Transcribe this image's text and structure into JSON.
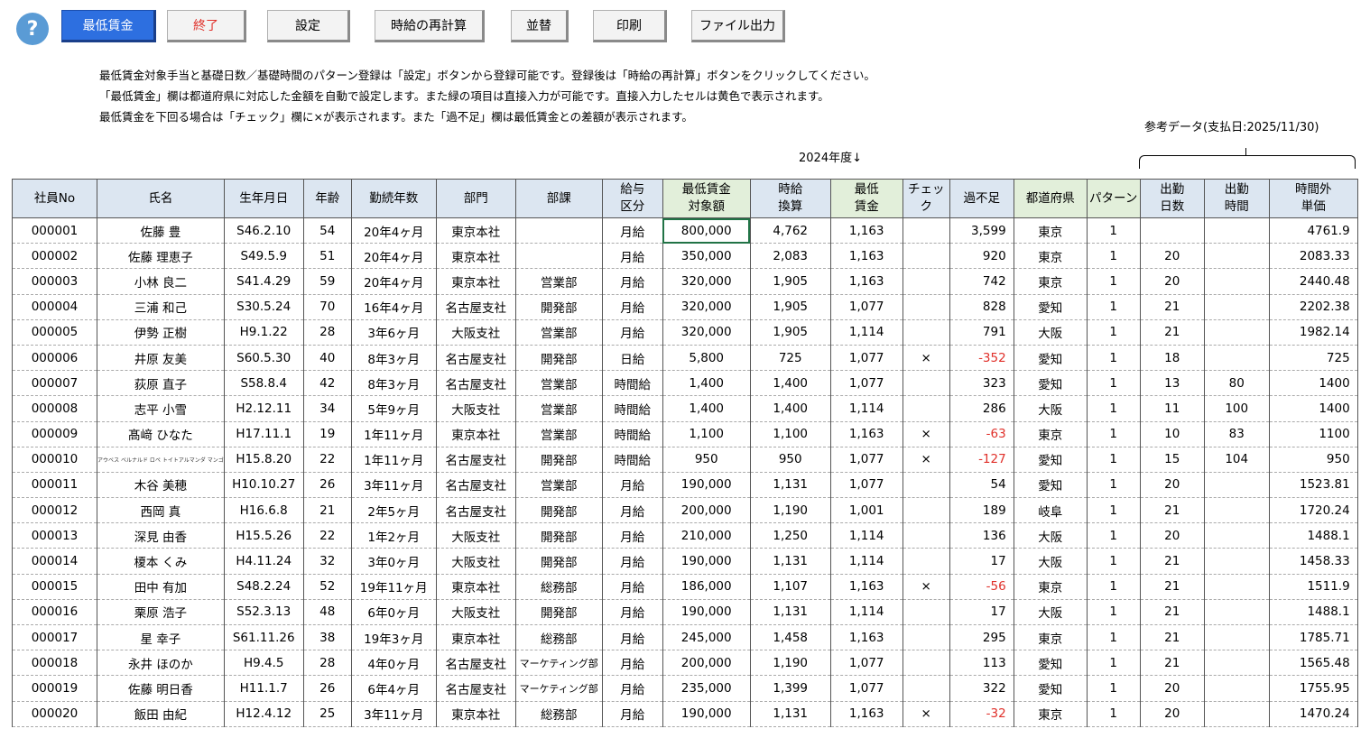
{
  "toolbar": {
    "help": "?",
    "minwage": "最低賃金",
    "exit": "終了",
    "settings": "設定",
    "recalc": "時給の再計算",
    "sort": "並替",
    "print": "印刷",
    "export": "ファイル出力"
  },
  "info": {
    "line1": "最低賃金対象手当と基礎日数／基礎時間のパターン登録は「設定」ボタンから登録可能です。登録後は「時給の再計算」ボタンをクリックしてください。",
    "line2": "「最低賃金」欄は都道府県に対応した金額を自動で設定します。また緑の項目は直接入力が可能です。直接入力したセルは黄色で表示されます。",
    "line3": "最低賃金を下回る場合は「チェック」欄に×が表示されます。また「過不足」欄は最低賃金との差額が表示されます。"
  },
  "ref_label": "参考データ(支払日:2025/11/30)",
  "year_label": "2024年度↓",
  "headers": [
    {
      "l1": "社員No",
      "l2": ""
    },
    {
      "l1": "氏名",
      "l2": ""
    },
    {
      "l1": "生年月日",
      "l2": ""
    },
    {
      "l1": "年齢",
      "l2": ""
    },
    {
      "l1": "勤続年数",
      "l2": ""
    },
    {
      "l1": "部門",
      "l2": ""
    },
    {
      "l1": "部課",
      "l2": ""
    },
    {
      "l1": "給与",
      "l2": "区分"
    },
    {
      "l1": "最低賃金",
      "l2": "対象額"
    },
    {
      "l1": "時給",
      "l2": "換算"
    },
    {
      "l1": "最低",
      "l2": "賃金"
    },
    {
      "l1": "チェック",
      "l2": ""
    },
    {
      "l1": "過不足",
      "l2": ""
    },
    {
      "l1": "都道府県",
      "l2": ""
    },
    {
      "l1": "パターン",
      "l2": ""
    },
    {
      "l1": "出勤",
      "l2": "日数"
    },
    {
      "l1": "出勤",
      "l2": "時間"
    },
    {
      "l1": "時間外",
      "l2": "単価"
    }
  ],
  "rows": [
    [
      "000001",
      "佐藤 豊",
      "S46.2.10",
      "54",
      "20年4ヶ月",
      "東京本社",
      "",
      "月給",
      "800,000",
      "4,762",
      "1,163",
      "",
      "3,599",
      "東京",
      "1",
      "",
      "",
      "4761.9"
    ],
    [
      "000002",
      "佐藤 理恵子",
      "S49.5.9",
      "51",
      "20年4ヶ月",
      "東京本社",
      "",
      "月給",
      "350,000",
      "2,083",
      "1,163",
      "",
      "920",
      "東京",
      "1",
      "20",
      "",
      "2083.33"
    ],
    [
      "000003",
      "小林 良二",
      "S41.4.29",
      "59",
      "20年4ヶ月",
      "東京本社",
      "営業部",
      "月給",
      "320,000",
      "1,905",
      "1,163",
      "",
      "742",
      "東京",
      "1",
      "20",
      "",
      "2440.48"
    ],
    [
      "000004",
      "三浦 和己",
      "S30.5.24",
      "70",
      "16年4ヶ月",
      "名古屋支社",
      "開発部",
      "月給",
      "320,000",
      "1,905",
      "1,077",
      "",
      "828",
      "愛知",
      "1",
      "21",
      "",
      "2202.38"
    ],
    [
      "000005",
      "伊勢 正樹",
      "H9.1.22",
      "28",
      "3年6ヶ月",
      "大阪支社",
      "営業部",
      "月給",
      "320,000",
      "1,905",
      "1,114",
      "",
      "791",
      "大阪",
      "1",
      "21",
      "",
      "1982.14"
    ],
    [
      "000006",
      "井原 友美",
      "S60.5.30",
      "40",
      "8年3ヶ月",
      "名古屋支社",
      "開発部",
      "日給",
      "5,800",
      "725",
      "1,077",
      "×",
      "-352",
      "愛知",
      "1",
      "18",
      "",
      "725"
    ],
    [
      "000007",
      "荻原 直子",
      "S58.8.4",
      "42",
      "8年3ヶ月",
      "名古屋支社",
      "営業部",
      "時間給",
      "1,400",
      "1,400",
      "1,077",
      "",
      "323",
      "愛知",
      "1",
      "13",
      "80",
      "1400"
    ],
    [
      "000008",
      "志平 小雪",
      "H2.12.11",
      "34",
      "5年9ヶ月",
      "大阪支社",
      "営業部",
      "時間給",
      "1,400",
      "1,400",
      "1,114",
      "",
      "286",
      "大阪",
      "1",
      "11",
      "100",
      "1400"
    ],
    [
      "000009",
      "髙﨑 ひなた",
      "H17.11.1",
      "19",
      "1年11ヶ月",
      "東京本社",
      "営業部",
      "時間給",
      "1,100",
      "1,100",
      "1,163",
      "×",
      "-63",
      "東京",
      "1",
      "10",
      "83",
      "1100"
    ],
    [
      "000010",
      "アウベス ベルナルド ロペ トイトアルマンダ マンゴ",
      "H15.8.20",
      "22",
      "1年11ヶ月",
      "名古屋支社",
      "開発部",
      "時間給",
      "950",
      "950",
      "1,077",
      "×",
      "-127",
      "愛知",
      "1",
      "15",
      "104",
      "950"
    ],
    [
      "000011",
      "木谷 美穂",
      "H10.10.27",
      "26",
      "3年11ヶ月",
      "名古屋支社",
      "営業部",
      "月給",
      "190,000",
      "1,131",
      "1,077",
      "",
      "54",
      "愛知",
      "1",
      "20",
      "",
      "1523.81"
    ],
    [
      "000012",
      "西岡 真",
      "H16.6.8",
      "21",
      "2年5ヶ月",
      "名古屋支社",
      "開発部",
      "月給",
      "200,000",
      "1,190",
      "1,001",
      "",
      "189",
      "岐阜",
      "1",
      "21",
      "",
      "1720.24"
    ],
    [
      "000013",
      "深見 由香",
      "H15.5.26",
      "22",
      "1年2ヶ月",
      "大阪支社",
      "開発部",
      "月給",
      "210,000",
      "1,250",
      "1,114",
      "",
      "136",
      "大阪",
      "1",
      "20",
      "",
      "1488.1"
    ],
    [
      "000014",
      "榎本 くみ",
      "H4.11.24",
      "32",
      "3年0ヶ月",
      "大阪支社",
      "開発部",
      "月給",
      "190,000",
      "1,131",
      "1,114",
      "",
      "17",
      "大阪",
      "1",
      "21",
      "",
      "1458.33"
    ],
    [
      "000015",
      "田中 有加",
      "S48.2.24",
      "52",
      "19年11ヶ月",
      "東京本社",
      "総務部",
      "月給",
      "186,000",
      "1,107",
      "1,163",
      "×",
      "-56",
      "東京",
      "1",
      "21",
      "",
      "1511.9"
    ],
    [
      "000016",
      "栗原 浩子",
      "S52.3.13",
      "48",
      "6年0ヶ月",
      "大阪支社",
      "開発部",
      "月給",
      "190,000",
      "1,131",
      "1,114",
      "",
      "17",
      "大阪",
      "1",
      "21",
      "",
      "1488.1"
    ],
    [
      "000017",
      "星 幸子",
      "S61.11.26",
      "38",
      "19年3ヶ月",
      "東京本社",
      "総務部",
      "月給",
      "245,000",
      "1,458",
      "1,163",
      "",
      "295",
      "東京",
      "1",
      "21",
      "",
      "1785.71"
    ],
    [
      "000018",
      "永井 ほのか",
      "H9.4.5",
      "28",
      "4年0ヶ月",
      "名古屋支社",
      "マーケティング部",
      "月給",
      "200,000",
      "1,190",
      "1,077",
      "",
      "113",
      "愛知",
      "1",
      "21",
      "",
      "1565.48"
    ],
    [
      "000019",
      "佐藤 明日香",
      "H11.1.7",
      "26",
      "6年4ヶ月",
      "名古屋支社",
      "マーケティング部",
      "月給",
      "235,000",
      "1,399",
      "1,077",
      "",
      "322",
      "愛知",
      "1",
      "20",
      "",
      "1755.95"
    ],
    [
      "000020",
      "飯田 由紀",
      "H12.4.12",
      "25",
      "3年11ヶ月",
      "東京本社",
      "総務部",
      "月給",
      "190,000",
      "1,131",
      "1,163",
      "×",
      "-32",
      "東京",
      "1",
      "20",
      "",
      "1470.24"
    ]
  ],
  "colors": {
    "primary": "#2d6fe0",
    "header_blue": "#dce6f1",
    "header_green": "#e2efda",
    "negative": "#e0302a"
  }
}
